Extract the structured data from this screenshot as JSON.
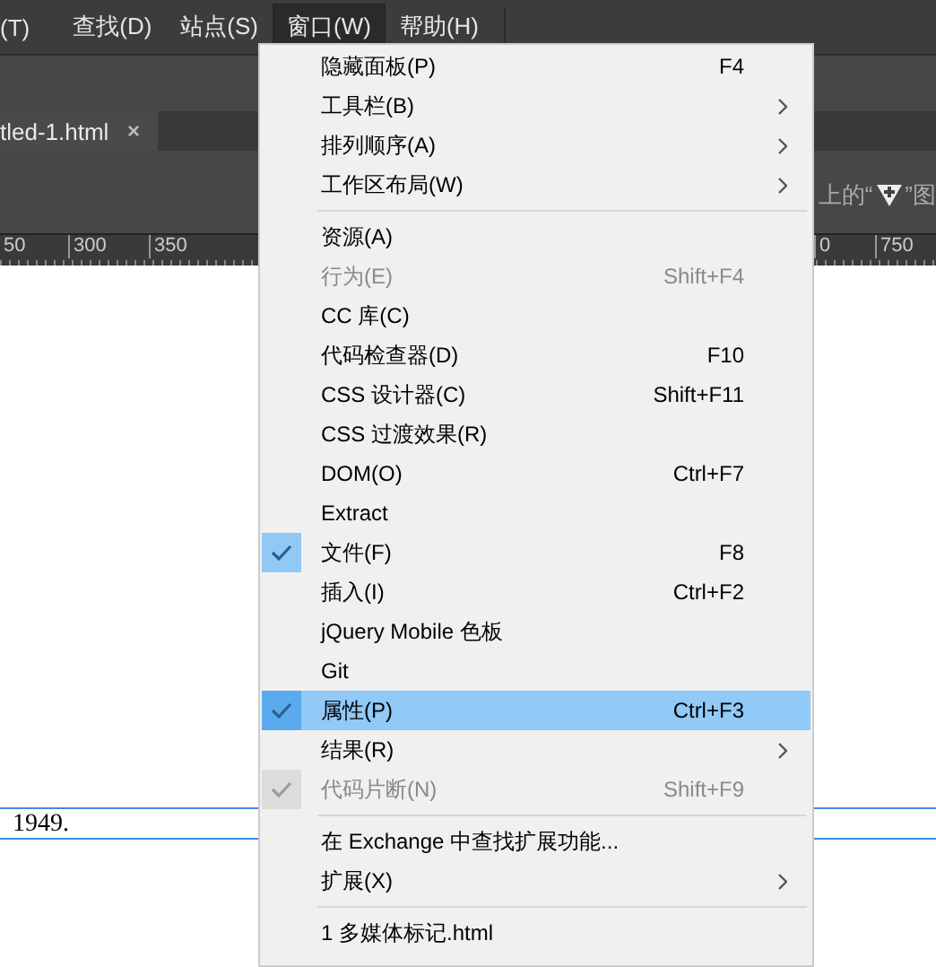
{
  "menubar": [
    {
      "label": "(T)",
      "selected": false
    },
    {
      "label": "查找(D)",
      "selected": false
    },
    {
      "label": "站点(S)",
      "selected": false
    },
    {
      "label": "窗口(W)",
      "selected": true
    },
    {
      "label": "帮助(H)",
      "selected": false
    }
  ],
  "document_tab": {
    "title": "tled-1.html",
    "close": "×"
  },
  "hint": {
    "before": "上的“",
    "after": "”图"
  },
  "ruler": {
    "left_labels": [
      "50",
      "300",
      "350"
    ],
    "right_labels": [
      "0",
      "750"
    ]
  },
  "document": {
    "lines": [
      "1949."
    ]
  },
  "menu": {
    "items": [
      {
        "kind": "item",
        "label": "隐藏面板(P)",
        "shortcut": "F4",
        "submenu": false,
        "checked": false,
        "disabled": false,
        "selected": false
      },
      {
        "kind": "item",
        "label": "工具栏(B)",
        "submenu": true,
        "checked": false,
        "disabled": false,
        "selected": false
      },
      {
        "kind": "item",
        "label": "排列顺序(A)",
        "submenu": true,
        "checked": false,
        "disabled": false,
        "selected": false
      },
      {
        "kind": "item",
        "label": "工作区布局(W)",
        "submenu": true,
        "checked": false,
        "disabled": false,
        "selected": false
      },
      {
        "kind": "separator"
      },
      {
        "kind": "item",
        "label": "资源(A)",
        "submenu": false,
        "checked": false,
        "disabled": false,
        "selected": false
      },
      {
        "kind": "item",
        "label": "行为(E)",
        "shortcut": "Shift+F4",
        "submenu": false,
        "checked": false,
        "disabled": true,
        "selected": false
      },
      {
        "kind": "item",
        "label": "CC 库(C)",
        "submenu": false,
        "checked": false,
        "disabled": false,
        "selected": false
      },
      {
        "kind": "item",
        "label": "代码检查器(D)",
        "shortcut": "F10",
        "submenu": false,
        "checked": false,
        "disabled": false,
        "selected": false
      },
      {
        "kind": "item",
        "label": "CSS 设计器(C)",
        "shortcut": "Shift+F11",
        "submenu": false,
        "checked": false,
        "disabled": false,
        "selected": false
      },
      {
        "kind": "item",
        "label": "CSS 过渡效果(R)",
        "submenu": false,
        "checked": false,
        "disabled": false,
        "selected": false
      },
      {
        "kind": "item",
        "label": "DOM(O)",
        "shortcut": "Ctrl+F7",
        "submenu": false,
        "checked": false,
        "disabled": false,
        "selected": false
      },
      {
        "kind": "item",
        "label": "Extract",
        "submenu": false,
        "checked": false,
        "disabled": false,
        "selected": false
      },
      {
        "kind": "item",
        "label": "文件(F)",
        "shortcut": "F8",
        "submenu": false,
        "checked": true,
        "disabled": false,
        "selected": false
      },
      {
        "kind": "item",
        "label": "插入(I)",
        "shortcut": "Ctrl+F2",
        "submenu": false,
        "checked": false,
        "disabled": false,
        "selected": false
      },
      {
        "kind": "item",
        "label": "jQuery Mobile 色板",
        "submenu": false,
        "checked": false,
        "disabled": false,
        "selected": false
      },
      {
        "kind": "item",
        "label": "Git",
        "submenu": false,
        "checked": false,
        "disabled": false,
        "selected": false
      },
      {
        "kind": "item",
        "label": "属性(P)",
        "shortcut": "Ctrl+F3",
        "submenu": false,
        "checked": true,
        "disabled": false,
        "selected": true
      },
      {
        "kind": "item",
        "label": "结果(R)",
        "submenu": true,
        "checked": false,
        "disabled": false,
        "selected": false
      },
      {
        "kind": "item",
        "label": "代码片断(N)",
        "shortcut": "Shift+F9",
        "submenu": false,
        "checked": true,
        "disabled": true,
        "selected": false
      },
      {
        "kind": "separator"
      },
      {
        "kind": "item",
        "label": "在 Exchange 中查找扩展功能...",
        "submenu": false,
        "checked": false,
        "disabled": false,
        "selected": false
      },
      {
        "kind": "item",
        "label": "扩展(X)",
        "submenu": true,
        "checked": false,
        "disabled": false,
        "selected": false
      },
      {
        "kind": "separator"
      },
      {
        "kind": "item",
        "label": "1 多媒体标记.html",
        "submenu": false,
        "checked": false,
        "disabled": false,
        "selected": false
      }
    ]
  }
}
